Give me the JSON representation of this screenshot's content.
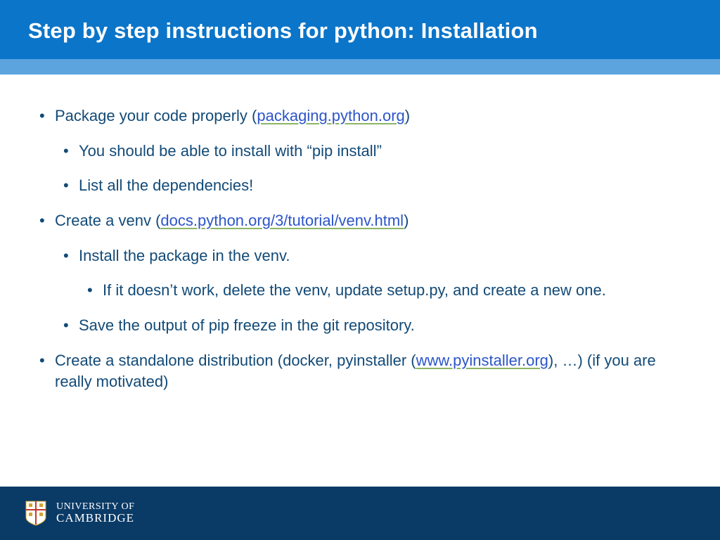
{
  "title": "Step by step instructions for python: Installation",
  "b1_pre": "Package your code properly (",
  "b1_link": "packaging.python.org",
  "b1_post": ")",
  "b1_s1": "You should be able to install with “pip install”",
  "b1_s2": "List all the dependencies!",
  "b2_pre": "Create a venv (",
  "b2_link": "docs.python.org/3/tutorial/venv.html",
  "b2_post": ")",
  "b2_s1": "Install the package in the venv.",
  "b2_s1_s1": "If it doesn’t work, delete the venv, update setup.py, and create a new one.",
  "b2_s2": "Save the output of pip freeze in the git repository.",
  "b3_pre": "Create a standalone distribution (docker, pyinstaller (",
  "b3_link": "www.pyinstaller.org",
  "b3_post": "), …) (if you are really motivated)",
  "footer_line1": "UNIVERSITY OF",
  "footer_line2": "CAMBRIDGE"
}
